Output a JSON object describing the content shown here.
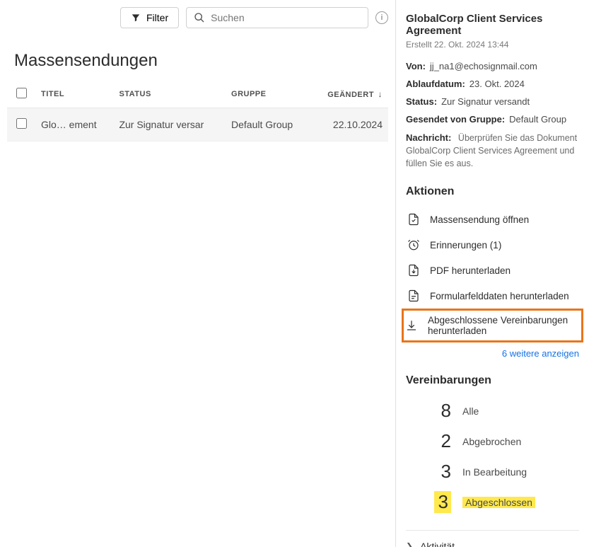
{
  "topbar": {
    "filter_label": "Filter",
    "search_placeholder": "Suchen"
  },
  "page_title": "Massensendungen",
  "table": {
    "columns": [
      "TITEL",
      "STATUS",
      "GRUPPE",
      "GEÄNDERT"
    ],
    "rows": [
      {
        "title": "Glo… ement",
        "status": "Zur Signatur versar",
        "group": "Default Group",
        "changed": "22.10.2024",
        "selected": true
      }
    ]
  },
  "detail": {
    "title": "GlobalCorp Client Services Agreement",
    "created": "Erstellt 22. Okt. 2024 13:44",
    "from_label": "Von:",
    "from_value": "jj_na1@echosignmail.com",
    "expiry_label": "Ablaufdatum:",
    "expiry_value": "23. Okt. 2024",
    "status_label": "Status:",
    "status_value": "Zur Signatur versandt",
    "group_label": "Gesendet von Gruppe:",
    "group_value": "Default Group",
    "message_label": "Nachricht:",
    "message_value": "Überprüfen Sie das Dokument GlobalCorp Client Services Agreement und füllen Sie es aus."
  },
  "actions": {
    "title": "Aktionen",
    "items": [
      {
        "icon": "open-icon",
        "label": "Massensendung öffnen"
      },
      {
        "icon": "clock-icon",
        "label": "Erinnerungen (1)"
      },
      {
        "icon": "pdf-icon",
        "label": "PDF herunterladen"
      },
      {
        "icon": "form-icon",
        "label": "Formularfelddaten herunterladen"
      },
      {
        "icon": "download-icon",
        "label": "Abgeschlossene Vereinbarungen herunterladen",
        "highlight": true
      }
    ],
    "more_label": "6 weitere anzeigen"
  },
  "agreements": {
    "title": "Vereinbarungen",
    "items": [
      {
        "count": "8",
        "label": "Alle"
      },
      {
        "count": "2",
        "label": "Abgebrochen"
      },
      {
        "count": "3",
        "label": "In Bearbeitung"
      },
      {
        "count": "3",
        "label": "Abgeschlossen",
        "highlight": true
      }
    ]
  },
  "activity_label": "Aktivität"
}
